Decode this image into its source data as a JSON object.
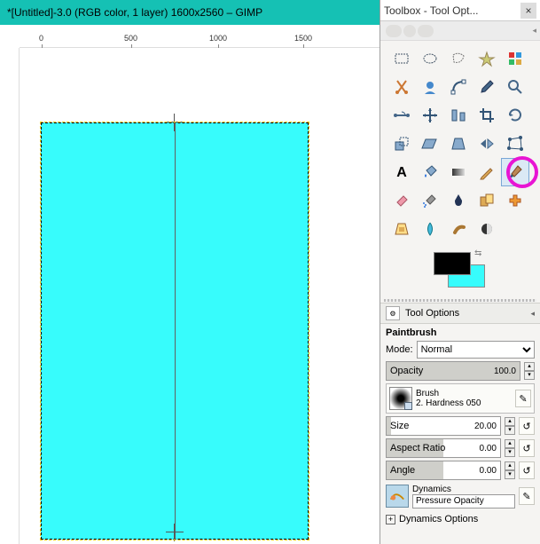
{
  "main": {
    "title": "*[Untitled]-3.0 (RGB color, 1 layer) 1600x2560 – GIMP",
    "ruler_ticks": [
      "0",
      "500",
      "1000",
      "1500"
    ]
  },
  "toolbox": {
    "title": "Toolbox - Tool Opt...",
    "close_glyph": "×",
    "tools": [
      {
        "name": "rectangle-select",
        "title": "Rectangle Select"
      },
      {
        "name": "ellipse-select",
        "title": "Ellipse Select"
      },
      {
        "name": "free-select",
        "title": "Free Select"
      },
      {
        "name": "fuzzy-select",
        "title": "Fuzzy Select"
      },
      {
        "name": "color-select",
        "title": "Select by Color"
      },
      {
        "name": "scissors",
        "title": "Scissors Select"
      },
      {
        "name": "foreground-select",
        "title": "Foreground Select"
      },
      {
        "name": "paths",
        "title": "Paths"
      },
      {
        "name": "color-picker",
        "title": "Color Picker"
      },
      {
        "name": "zoom",
        "title": "Zoom"
      },
      {
        "name": "measure",
        "title": "Measure"
      },
      {
        "name": "move",
        "title": "Move"
      },
      {
        "name": "align",
        "title": "Align"
      },
      {
        "name": "crop",
        "title": "Crop"
      },
      {
        "name": "rotate",
        "title": "Rotate"
      },
      {
        "name": "scale",
        "title": "Scale"
      },
      {
        "name": "shear",
        "title": "Shear"
      },
      {
        "name": "perspective",
        "title": "Perspective"
      },
      {
        "name": "flip",
        "title": "Flip"
      },
      {
        "name": "cage",
        "title": "Cage Transform"
      },
      {
        "name": "text",
        "title": "Text"
      },
      {
        "name": "bucket",
        "title": "Bucket Fill"
      },
      {
        "name": "blend",
        "title": "Blend"
      },
      {
        "name": "pencil",
        "title": "Pencil"
      },
      {
        "name": "paintbrush",
        "title": "Paintbrush",
        "active": true
      },
      {
        "name": "eraser",
        "title": "Eraser"
      },
      {
        "name": "airbrush",
        "title": "Airbrush"
      },
      {
        "name": "ink",
        "title": "Ink"
      },
      {
        "name": "clone",
        "title": "Clone"
      },
      {
        "name": "heal",
        "title": "Heal"
      },
      {
        "name": "perspective-clone",
        "title": "Perspective Clone"
      },
      {
        "name": "blur",
        "title": "Blur / Sharpen"
      },
      {
        "name": "smudge",
        "title": "Smudge"
      },
      {
        "name": "dodge-burn",
        "title": "Dodge / Burn"
      }
    ],
    "colors": {
      "fg": "#000000",
      "bg": "#37fcfc"
    }
  },
  "tool_options": {
    "header": "Tool Options",
    "tool_name": "Paintbrush",
    "mode_label": "Mode:",
    "mode_value": "Normal",
    "opacity_label": "Opacity",
    "opacity_value": "100.0",
    "brush_label": "Brush",
    "brush_name": "2. Hardness 050",
    "size_label": "Size",
    "size_value": "20.00",
    "aspect_label": "Aspect Ratio",
    "aspect_value": "0.00",
    "angle_label": "Angle",
    "angle_value": "0.00",
    "dynamics_label": "Dynamics",
    "dynamics_value": "Pressure Opacity",
    "dynamics_options_label": "Dynamics Options"
  }
}
